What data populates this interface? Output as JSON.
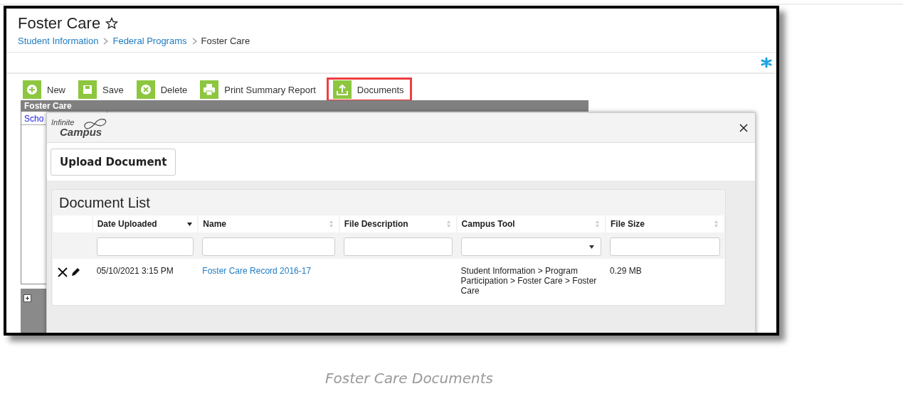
{
  "page": {
    "title": "Foster Care",
    "favorite": false,
    "breadcrumb": [
      {
        "label": "Student Information",
        "link": true
      },
      {
        "label": "Federal Programs",
        "link": true
      },
      {
        "label": "Foster Care",
        "link": false
      }
    ]
  },
  "toolbar": [
    {
      "label": "New",
      "kind": "new",
      "highlighted": false
    },
    {
      "label": "Save",
      "kind": "save",
      "highlighted": false
    },
    {
      "label": "Delete",
      "kind": "delete",
      "highlighted": false
    },
    {
      "label": "Print Summary Report",
      "kind": "print",
      "highlighted": false
    },
    {
      "label": "Documents",
      "kind": "documents",
      "highlighted": true
    }
  ],
  "background_panel": {
    "title": "Foster Care",
    "column_1": "Scho"
  },
  "modal": {
    "logo": {
      "line_1": "Infinite",
      "line_2": "Campus"
    },
    "upload_button": "Upload Document",
    "document_list": {
      "title": "Document List",
      "columns": [
        {
          "label": "Date Uploaded",
          "sorted": true
        },
        {
          "label": "Name",
          "sorted": false
        },
        {
          "label": "File Description",
          "sorted": false
        },
        {
          "label": "Campus Tool",
          "sorted": false
        },
        {
          "label": "File Size",
          "sorted": false
        }
      ],
      "filters": [
        {
          "kind": "text"
        },
        {
          "kind": "text"
        },
        {
          "kind": "text"
        },
        {
          "kind": "select"
        },
        {
          "kind": "text"
        }
      ],
      "rows": [
        {
          "date_uploaded": "05/10/2021 3:15 PM",
          "name": "Foster Care Record 2016-17",
          "name_link": true,
          "campus_tool": "Student Information > Program Participation > Foster Care > Foster Care",
          "file_size": "0.29 MB"
        }
      ]
    }
  },
  "caption": "Foster Care Documents"
}
